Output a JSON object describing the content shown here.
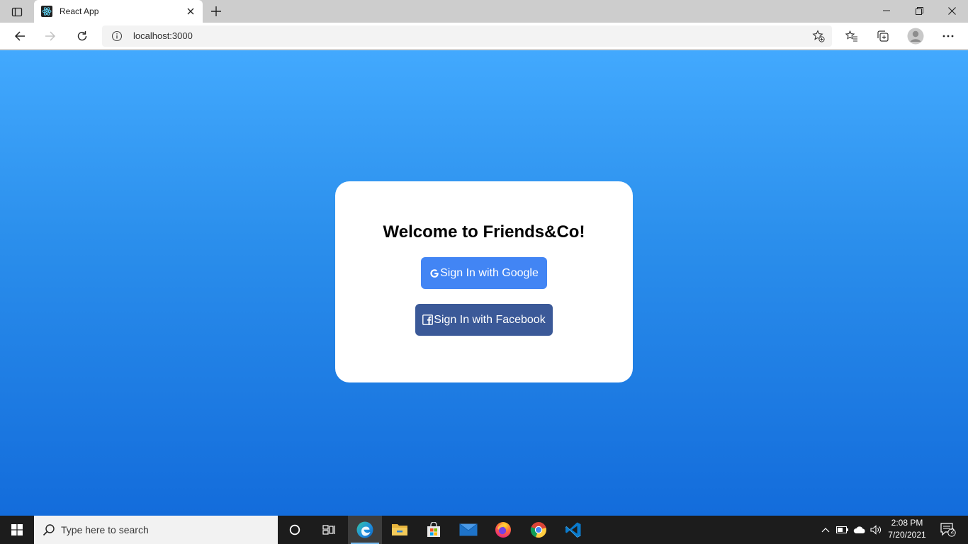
{
  "browser": {
    "tab": {
      "title": "React App"
    },
    "address": {
      "url": "localhost:3000"
    }
  },
  "page": {
    "welcome": "Welcome to Friends&Co!",
    "google_button": "Sign In with Google",
    "facebook_button": "Sign In with Facebook"
  },
  "colors": {
    "gradient_top": "#42a9fe",
    "gradient_bottom": "#136cdb",
    "google": "#4285f4",
    "facebook": "#3b5998"
  },
  "taskbar": {
    "search_placeholder": "Type here to search",
    "time": "2:08 PM",
    "date": "7/20/2021",
    "notification_count": "2",
    "apps": [
      "cortana-icon",
      "task-view-icon",
      "edge-icon",
      "file-explorer-icon",
      "store-icon",
      "mail-icon",
      "firefox-icon",
      "chrome-icon",
      "vscode-icon"
    ]
  }
}
